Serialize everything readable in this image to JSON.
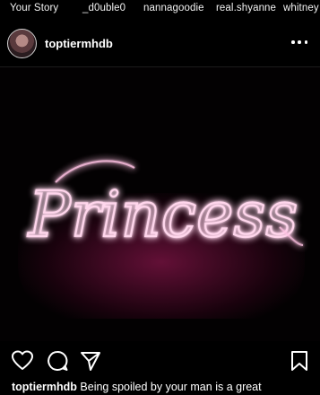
{
  "stories": [
    {
      "label": "Your Story"
    },
    {
      "label": "_d0uble0"
    },
    {
      "label": "nannagoodie"
    },
    {
      "label": "real.shyanne"
    },
    {
      "label": "whitney"
    }
  ],
  "post": {
    "username": "toptiermhdb",
    "image_text": "Princess",
    "caption_user": "toptiermhdb",
    "caption_text": "Being spoiled by your man is a great"
  },
  "icons": {
    "more": "more-options-icon",
    "like": "heart-icon",
    "comment": "comment-icon",
    "share": "send-icon",
    "save": "bookmark-icon"
  },
  "colors": {
    "background": "#000000",
    "text": "#ffffff",
    "neon": "#ff4fb0",
    "neon_glow": "#e0197a"
  }
}
